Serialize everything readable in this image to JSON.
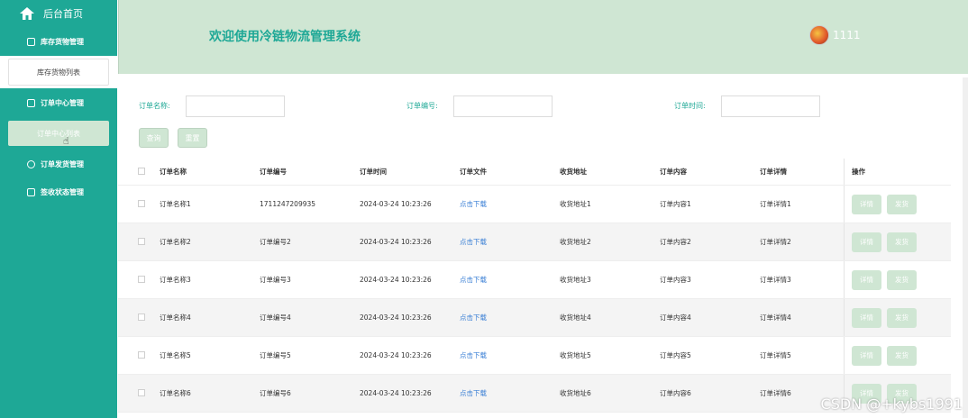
{
  "sidebar": {
    "home_label": "后台首页",
    "groups": [
      {
        "label": "库存货物管理"
      },
      {
        "label": "订单中心管理"
      },
      {
        "label": "订单发货管理"
      },
      {
        "label": "签收状态管理"
      }
    ],
    "sub_inventory_list": "库存货物列表",
    "sub_order_list": "订单中心列表"
  },
  "header": {
    "title": "欢迎使用冷链物流管理系统",
    "username": "1111"
  },
  "filters": {
    "order_name_label": "订单名称:",
    "order_no_label": "订单编号:",
    "order_time_label": "订单时间:",
    "query_button": "查询",
    "reset_button": "重置"
  },
  "table": {
    "columns": [
      "订单名称",
      "订单编号",
      "订单时间",
      "订单文件",
      "收货地址",
      "订单内容",
      "订单详情",
      "操作"
    ],
    "rows": [
      {
        "name": "订单名称1",
        "no": "1711247209935",
        "time": "2024-03-24 10:23:26",
        "file": "点击下载",
        "addr": "收货地址1",
        "content": "订单内容1",
        "detail": "订单详情1"
      },
      {
        "name": "订单名称2",
        "no": "订单编号2",
        "time": "2024-03-24 10:23:26",
        "file": "点击下载",
        "addr": "收货地址2",
        "content": "订单内容2",
        "detail": "订单详情2"
      },
      {
        "name": "订单名称3",
        "no": "订单编号3",
        "time": "2024-03-24 10:23:26",
        "file": "点击下载",
        "addr": "收货地址3",
        "content": "订单内容3",
        "detail": "订单详情3"
      },
      {
        "name": "订单名称4",
        "no": "订单编号4",
        "time": "2024-03-24 10:23:26",
        "file": "点击下载",
        "addr": "收货地址4",
        "content": "订单内容4",
        "detail": "订单详情4"
      },
      {
        "name": "订单名称5",
        "no": "订单编号5",
        "time": "2024-03-24 10:23:26",
        "file": "点击下载",
        "addr": "收货地址5",
        "content": "订单内容5",
        "detail": "订单详情5"
      },
      {
        "name": "订单名称6",
        "no": "订单编号6",
        "time": "2024-03-24 10:23:26",
        "file": "点击下载",
        "addr": "收货地址6",
        "content": "订单内容6",
        "detail": "订单详情6"
      }
    ],
    "op_detail": "详情",
    "op_ship": "发货"
  },
  "watermark": "CSDN @+kybs1991",
  "colors": {
    "accent": "#1ea896",
    "light": "#cfe6d3",
    "link": "#3a7fd5"
  }
}
